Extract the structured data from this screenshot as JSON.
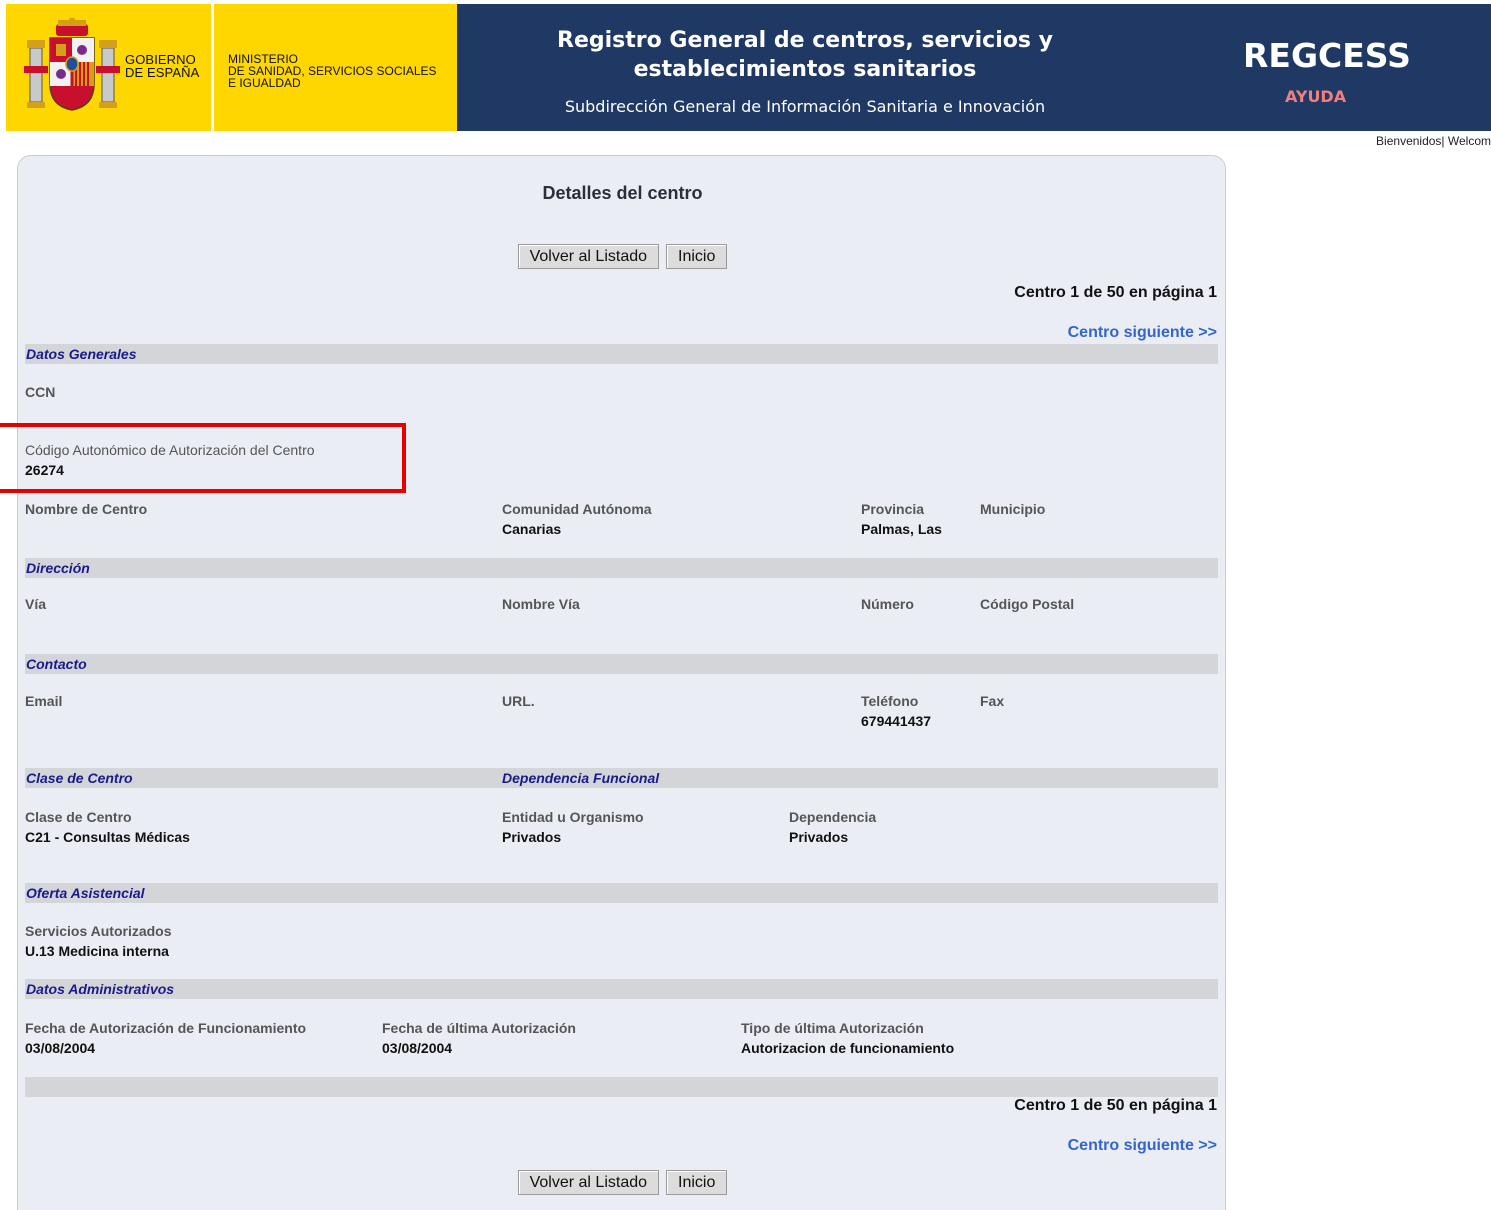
{
  "header": {
    "gov_line1": "GOBIERNO",
    "gov_line2": "DE ESPAÑA",
    "ministry_line1": "MINISTERIO",
    "ministry_line2": "DE SANIDAD, SERVICIOS SOCIALES",
    "ministry_line3": "E IGUALDAD",
    "title_line1": "Registro General de centros, servicios y",
    "title_line2": "establecimientos sanitarios",
    "subtitle": "Subdirección General de Información Sanitaria e Innovación",
    "brand": "REGCESS",
    "help_link": "AYUDA",
    "welcome": "Bienvenidos| Welcom"
  },
  "panel": {
    "title": "Detalles del centro",
    "back_button": "Volver al Listado",
    "home_button": "Inicio",
    "counter": "Centro 1 de 50 en página 1",
    "next_link": "Centro siguiente >>"
  },
  "sections": {
    "general": "Datos Generales",
    "address": "Dirección",
    "contact": "Contacto",
    "class": "Clase de Centro",
    "dependency": "Dependencia Funcional",
    "offer": "Oferta Asistencial",
    "admin": "Datos Administrativos"
  },
  "fields": {
    "ccn_label": "CCN",
    "ccn_value": "",
    "auth_code_label": "Código Autonómico de Autorización del Centro",
    "auth_code_value": "26274",
    "center_name_label": "Nombre de Centro",
    "center_name_value": "",
    "region_label": "Comunidad Autónoma",
    "region_value": "Canarias",
    "province_label": "Provincia",
    "province_value": "Palmas, Las",
    "municipality_label": "Municipio",
    "municipality_value": "",
    "street_type_label": "Vía",
    "street_name_label": "Nombre Vía",
    "number_label": "Número",
    "postal_code_label": "Código Postal",
    "email_label": "Email",
    "url_label": "URL.",
    "phone_label": "Teléfono",
    "phone_value": "679441437",
    "fax_label": "Fax",
    "class_label": "Clase de Centro",
    "class_value": "C21 - Consultas Médicas",
    "entity_label": "Entidad u Organismo",
    "entity_value": "Privados",
    "dependency_label": "Dependencia",
    "dependency_value": "Privados",
    "services_label": "Servicios Autorizados",
    "services_value": "U.13 Medicina interna",
    "op_auth_date_label": "Fecha de Autorización de Funcionamiento",
    "op_auth_date_value": "03/08/2004",
    "last_auth_date_label": "Fecha de última Autorización",
    "last_auth_date_value": "03/08/2004",
    "last_auth_type_label": "Tipo de última Autorización",
    "last_auth_type_value": "Autorizacion de funcionamiento"
  }
}
